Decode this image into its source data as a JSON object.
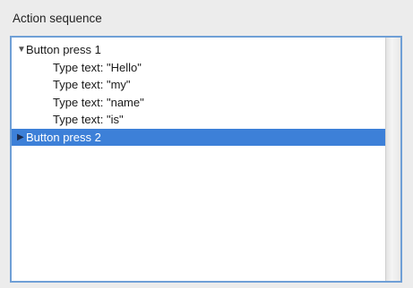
{
  "panel": {
    "title": "Action sequence"
  },
  "tree": {
    "items": [
      {
        "label": "Button press 1",
        "expanded": true,
        "selected": false,
        "arrow": "▼"
      },
      {
        "label": "Type text: \"Hello\""
      },
      {
        "label": "Type text: \"my\""
      },
      {
        "label": "Type text: \"name\""
      },
      {
        "label": "Type text: \"is\""
      },
      {
        "label": "Button press 2",
        "expanded": false,
        "selected": true,
        "arrow": "▶"
      }
    ]
  },
  "colors": {
    "selection": "#3d80d8",
    "focus_border": "#6f9fd6"
  }
}
